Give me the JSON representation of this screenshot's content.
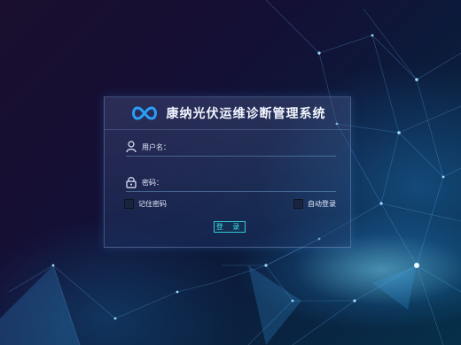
{
  "app": {
    "title": "康纳光伏运维诊断管理系统"
  },
  "login": {
    "username_label": "用户名：",
    "username_value": "",
    "password_label": "密码：",
    "password_value": "",
    "remember_label": "记住密码",
    "auto_login_label": "自动登录",
    "login_button": "登 录"
  },
  "colors": {
    "accent": "#3fe0ea",
    "logo": "#2a9df4",
    "text": "#e6ecff"
  },
  "icons": [
    "infinity-logo-icon",
    "user-icon",
    "lock-icon"
  ]
}
